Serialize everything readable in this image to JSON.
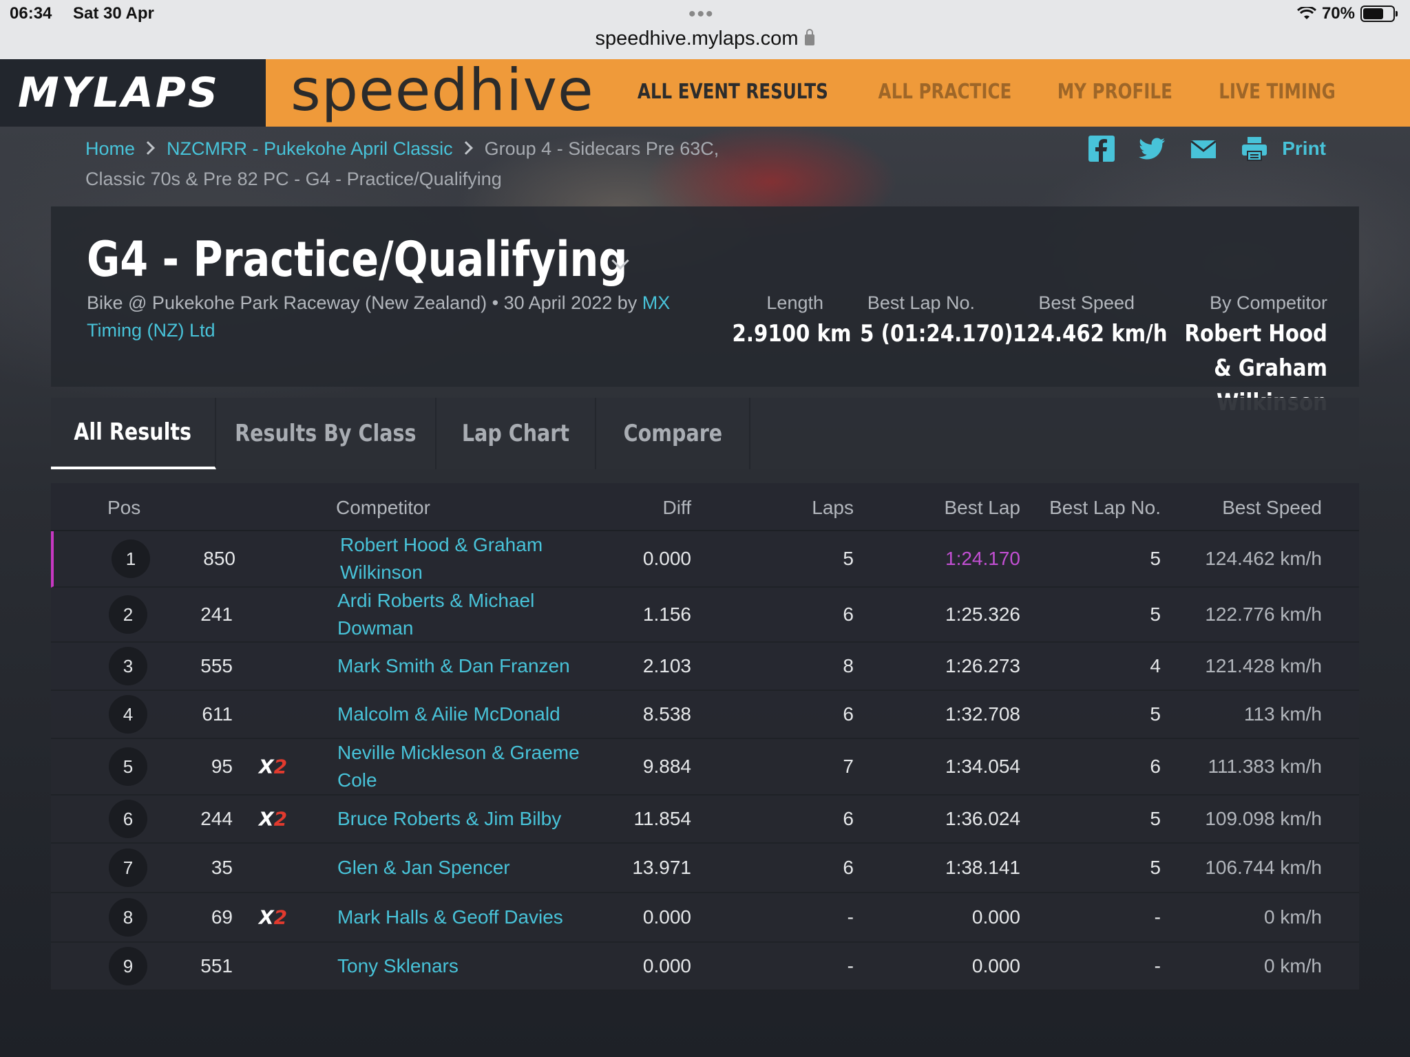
{
  "status_bar": {
    "time": "06:34",
    "date": "Sat 30 Apr",
    "battery": "70%",
    "battery_level": 0.7
  },
  "browser": {
    "url": "speedhive.mylaps.com"
  },
  "header": {
    "brand": "MYLAPS",
    "product": "speedhive",
    "nav": [
      "ALL EVENT RESULTS",
      "ALL PRACTICE",
      "MY PROFILE",
      "LIVE TIMING"
    ]
  },
  "breadcrumb": {
    "home": "Home",
    "event": "NZCMRR - Pukekohe April Classic",
    "current": "Group 4 - Sidecars Pre 63C, Classic 70s & Pre 82 PC - G4 - Practice/Qualifying"
  },
  "share": {
    "print": "Print"
  },
  "session": {
    "title": "G4 - Practice/Qualifying",
    "subtitle": "Bike @ Pukekohe Park Raceway (New Zealand) • 30 April 2022 by",
    "organizer": "MX Timing (NZ) Ltd",
    "stats": [
      {
        "label": "Length",
        "value": "2.9100 km"
      },
      {
        "label": "Best Lap No.",
        "value": "5 (01:24.170)"
      },
      {
        "label": "Best Speed",
        "value": "124.462 km/h"
      },
      {
        "label": "By Competitor",
        "value": "Robert Hood & Graham Wilkinson"
      }
    ]
  },
  "tabs": [
    "All Results",
    "Results By Class",
    "Lap Chart",
    "Compare"
  ],
  "table": {
    "headers": [
      "Pos",
      "Competitor",
      "Diff",
      "Laps",
      "Best Lap",
      "Best Lap No.",
      "Best Speed"
    ],
    "rows": [
      {
        "pos": "1",
        "num": "850",
        "x2": "",
        "competitor": "Robert Hood & Graham Wilkinson",
        "diff": "0.000",
        "laps": "5",
        "best_lap": "1:24.170",
        "best_lap_no": "5",
        "best_speed": "124.462 km/h"
      },
      {
        "pos": "2",
        "num": "241",
        "x2": "",
        "competitor": "Ardi Roberts & Michael Dowman",
        "diff": "1.156",
        "laps": "6",
        "best_lap": "1:25.326",
        "best_lap_no": "5",
        "best_speed": "122.776 km/h"
      },
      {
        "pos": "3",
        "num": "555",
        "x2": "",
        "competitor": "Mark Smith & Dan Franzen",
        "diff": "2.103",
        "laps": "8",
        "best_lap": "1:26.273",
        "best_lap_no": "4",
        "best_speed": "121.428 km/h"
      },
      {
        "pos": "4",
        "num": "611",
        "x2": "",
        "competitor": "Malcolm & Ailie McDonald",
        "diff": "8.538",
        "laps": "6",
        "best_lap": "1:32.708",
        "best_lap_no": "5",
        "best_speed": "113 km/h"
      },
      {
        "pos": "5",
        "num": "95",
        "x2": "X2",
        "competitor": "Neville Mickleson & Graeme Cole",
        "diff": "9.884",
        "laps": "7",
        "best_lap": "1:34.054",
        "best_lap_no": "6",
        "best_speed": "111.383 km/h"
      },
      {
        "pos": "6",
        "num": "244",
        "x2": "X2",
        "competitor": "Bruce Roberts & Jim Bilby",
        "diff": "11.854",
        "laps": "6",
        "best_lap": "1:36.024",
        "best_lap_no": "5",
        "best_speed": "109.098 km/h"
      },
      {
        "pos": "7",
        "num": "35",
        "x2": "",
        "competitor": "Glen & Jan Spencer",
        "diff": "13.971",
        "laps": "6",
        "best_lap": "1:38.141",
        "best_lap_no": "5",
        "best_speed": "106.744 km/h"
      },
      {
        "pos": "8",
        "num": "69",
        "x2": "X2",
        "competitor": "Mark Halls & Geoff Davies",
        "diff": "0.000",
        "laps": "-",
        "best_lap": "0.000",
        "best_lap_no": "-",
        "best_speed": "0 km/h"
      },
      {
        "pos": "9",
        "num": "551",
        "x2": "",
        "competitor": "Tony Sklenars",
        "diff": "0.000",
        "laps": "-",
        "best_lap": "0.000",
        "best_lap_no": "-",
        "best_speed": "0 km/h"
      }
    ]
  },
  "colors": {
    "accent": "#48c3d9",
    "brand_orange": "#ef9a3a",
    "best_lap_purple": "#c24fd3",
    "x2_red": "#e23a2e"
  }
}
